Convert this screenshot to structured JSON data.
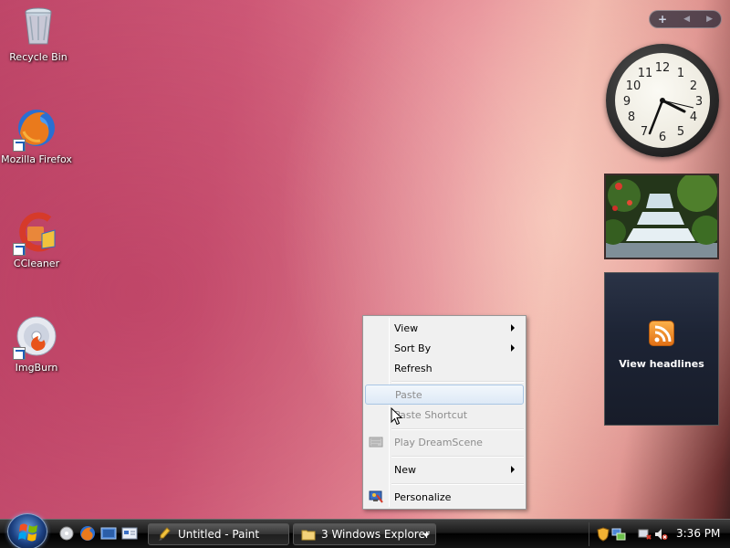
{
  "desktop": {
    "icons": [
      {
        "label": "Recycle Bin",
        "icon": "recycle-bin-icon"
      },
      {
        "label": "Mozilla Firefox",
        "icon": "firefox-icon"
      },
      {
        "label": "CCleaner",
        "icon": "ccleaner-icon"
      },
      {
        "label": "ImgBurn",
        "icon": "imgburn-icon"
      }
    ]
  },
  "sidebar": {
    "controls": {
      "add": "+",
      "prev": "◀",
      "next": "▶"
    },
    "clock": {
      "numerals": [
        "12",
        "1",
        "2",
        "3",
        "4",
        "5",
        "6",
        "7",
        "8",
        "9",
        "10",
        "11"
      ],
      "time": "3:36"
    },
    "slideshow": {
      "icon": "waterfall-photo"
    },
    "feed": {
      "label": "View headlines",
      "icon": "rss-icon"
    }
  },
  "context_menu": {
    "items": [
      {
        "label": "View",
        "submenu": true,
        "disabled": false
      },
      {
        "label": "Sort By",
        "submenu": true,
        "disabled": false
      },
      {
        "label": "Refresh",
        "submenu": false,
        "disabled": false
      },
      {
        "label": "Paste",
        "submenu": false,
        "disabled": true,
        "hover": true
      },
      {
        "label": "Paste Shortcut",
        "submenu": false,
        "disabled": true
      },
      {
        "label": "Play DreamScene",
        "submenu": false,
        "disabled": true,
        "icon": "dreamscene-icon"
      },
      {
        "label": "New",
        "submenu": true,
        "disabled": false
      },
      {
        "label": "Personalize",
        "submenu": false,
        "disabled": false,
        "icon": "personalize-icon"
      }
    ]
  },
  "taskbar": {
    "quick_launch": [
      "show-desktop-icon",
      "firefox-icon",
      "switch-windows-icon",
      "explorer-icon"
    ],
    "tasks": [
      {
        "label": "Untitled - Paint",
        "icon": "paint-icon"
      },
      {
        "label": "3 Windows Explorer",
        "icon": "folder-icon",
        "grouped": true
      }
    ],
    "tray": {
      "icons": [
        "security-shield-icon",
        "network-icon",
        "power-icon",
        "volume-muted-icon"
      ],
      "time": "3:36 PM"
    }
  },
  "colors": {
    "taskbar": "#1a1a1a",
    "menu_background": "#f0f0f0",
    "menu_hover": "#dde9f6",
    "disabled_text": "#8d8d8d",
    "feed_accent": "#e27015"
  }
}
